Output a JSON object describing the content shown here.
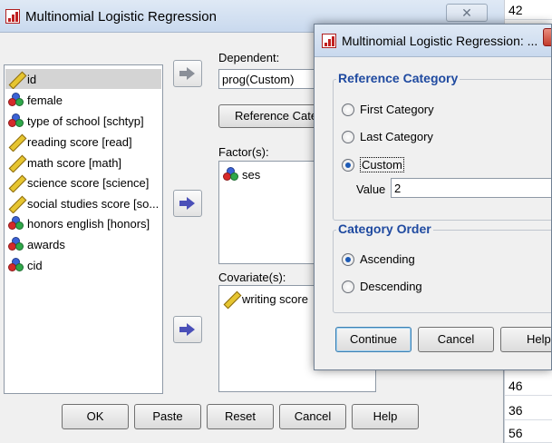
{
  "background_sheet": {
    "values_top": [
      "42"
    ],
    "values_bottom": [
      "46",
      "36",
      "56"
    ]
  },
  "main_dialog": {
    "title": "Multinomial Logistic Regression",
    "variables": [
      {
        "label": "id",
        "icon": "ruler-icon",
        "selected": true
      },
      {
        "label": "female",
        "icon": "nominal-icon"
      },
      {
        "label": "type of school [schtyp]",
        "icon": "nominal-icon"
      },
      {
        "label": "reading score [read]",
        "icon": "ruler-icon"
      },
      {
        "label": "math score [math]",
        "icon": "ruler-icon"
      },
      {
        "label": "science score [science]",
        "icon": "ruler-icon"
      },
      {
        "label": "social studies score [so...",
        "icon": "ruler-icon"
      },
      {
        "label": "honors english [honors]",
        "icon": "nominal-icon"
      },
      {
        "label": "awards",
        "icon": "nominal-icon"
      },
      {
        "label": "cid",
        "icon": "nominal-icon"
      }
    ],
    "dependent_label": "Dependent:",
    "dependent_value": "prog(Custom)",
    "reference_category_button": "Reference Cate",
    "factors_label": "Factor(s):",
    "factors": [
      "ses"
    ],
    "covariates_label": "Covariate(s):",
    "covariates": [
      "writing score"
    ],
    "buttons": {
      "ok": "OK",
      "paste": "Paste",
      "reset": "Reset",
      "cancel": "Cancel",
      "help": "Help"
    }
  },
  "sub_dialog": {
    "title": "Multinomial Logistic Regression: ...",
    "reference_category_title": "Reference Category",
    "first_category": "First Category",
    "last_category": "Last Category",
    "custom": "Custom",
    "value_label": "Value",
    "value": "2",
    "category_order_title": "Category Order",
    "ascending": "Ascending",
    "descending": "Descending",
    "buttons": {
      "continue": "Continue",
      "cancel": "Cancel",
      "help": "Help"
    }
  }
}
